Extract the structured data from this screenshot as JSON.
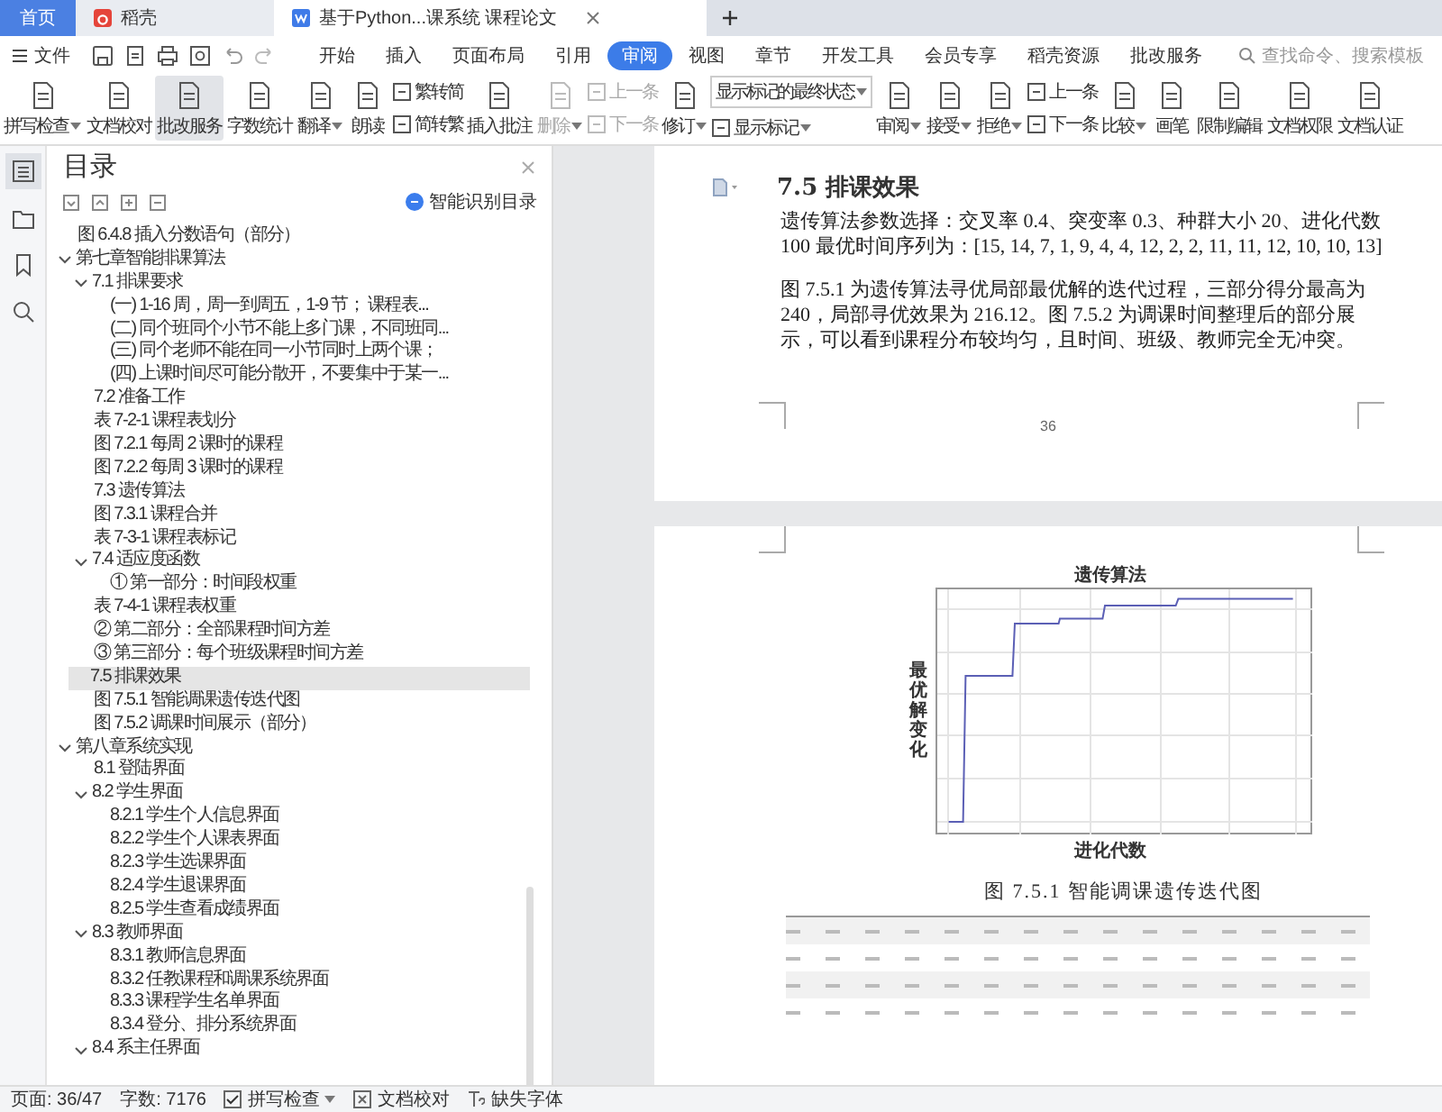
{
  "doc_tabs": [
    {
      "kind": "home",
      "label": "首页",
      "selected": false
    },
    {
      "kind": "app",
      "label": "稻壳",
      "selected": false
    },
    {
      "kind": "document",
      "label": "基于Python...课系统 课程论文",
      "selected": true
    }
  ],
  "menu": {
    "file_label": "文件",
    "tabs": [
      {
        "label": "开始",
        "selected": false
      },
      {
        "label": "插入",
        "selected": false
      },
      {
        "label": "页面布局",
        "selected": false
      },
      {
        "label": "引用",
        "selected": false
      },
      {
        "label": "审阅",
        "selected": true
      },
      {
        "label": "视图",
        "selected": false
      },
      {
        "label": "章节",
        "selected": false
      },
      {
        "label": "开发工具",
        "selected": false
      },
      {
        "label": "会员专享",
        "selected": false
      },
      {
        "label": "稻壳资源",
        "selected": false
      },
      {
        "label": "批改服务",
        "selected": false
      }
    ],
    "search": {
      "placeholder": "查找命令、搜索模板"
    }
  },
  "toolbar": [
    {
      "kind": "big",
      "label": "拼写检查",
      "dropdown": true,
      "disabled": false,
      "selected": false
    },
    {
      "kind": "big",
      "label": "文档校对",
      "dropdown": false,
      "disabled": false,
      "selected": false
    },
    {
      "kind": "big",
      "label": "批改服务",
      "dropdown": false,
      "disabled": false,
      "selected": true
    },
    {
      "kind": "big",
      "label": "字数统计",
      "dropdown": false,
      "disabled": false,
      "selected": false
    },
    {
      "kind": "big",
      "label": "翻译",
      "dropdown": true,
      "disabled": false,
      "selected": false
    },
    {
      "kind": "big",
      "label": "朗读",
      "dropdown": false,
      "disabled": false,
      "selected": false
    },
    {
      "kind": "pair",
      "items": [
        {
          "label": "繁转简",
          "disabled": false
        },
        {
          "label": "简转繁",
          "disabled": false
        }
      ]
    },
    {
      "kind": "big",
      "label": "插入批注",
      "dropdown": false,
      "disabled": false,
      "selected": false
    },
    {
      "kind": "big",
      "label": "删除",
      "dropdown": true,
      "disabled": true,
      "selected": false
    },
    {
      "kind": "pair",
      "items": [
        {
          "label": "上一条",
          "disabled": true
        },
        {
          "label": "下一条",
          "disabled": true
        }
      ]
    },
    {
      "kind": "big",
      "label": "修订",
      "dropdown": true,
      "disabled": false,
      "selected": false
    },
    {
      "kind": "select",
      "value": "显示标记的最终状态",
      "label": "显示标记"
    },
    {
      "kind": "big",
      "label": "审阅",
      "dropdown": true,
      "disabled": false,
      "selected": false
    },
    {
      "kind": "big",
      "label": "接受",
      "dropdown": true,
      "disabled": false,
      "selected": false
    },
    {
      "kind": "big",
      "label": "拒绝",
      "dropdown": true,
      "disabled": false,
      "selected": false
    },
    {
      "kind": "pair",
      "items": [
        {
          "label": "上一条",
          "disabled": false
        },
        {
          "label": "下一条",
          "disabled": false
        }
      ]
    },
    {
      "kind": "big",
      "label": "比较",
      "dropdown": true,
      "disabled": false,
      "selected": false
    },
    {
      "kind": "big",
      "label": "画笔",
      "dropdown": false,
      "disabled": false,
      "selected": false
    },
    {
      "kind": "big",
      "label": "限制编辑",
      "dropdown": false,
      "disabled": false,
      "selected": false
    },
    {
      "kind": "big",
      "label": "文档权限",
      "dropdown": false,
      "disabled": false,
      "selected": false
    },
    {
      "kind": "big",
      "label": "文档认证",
      "dropdown": false,
      "disabled": false,
      "selected": false
    }
  ],
  "rail": [
    {
      "kind": "contents",
      "selected": true
    },
    {
      "kind": "folder",
      "selected": false
    },
    {
      "kind": "bookmark",
      "selected": false
    },
    {
      "kind": "search",
      "selected": false
    }
  ],
  "toc": {
    "title": "目录",
    "smart_button": "智能识别目录",
    "items": [
      {
        "label": "图 6.4.8 插入分数语句（部分）",
        "selected": false
      },
      {
        "label": "第七章智能排课算法",
        "selected": false,
        "expanded": true,
        "children": [
          {
            "label": "7.1 排课要求",
            "selected": false,
            "expanded": true,
            "children": [
              {
                "label": "(一) 1-16 周，周一到周五，1-9 节； 课程表...",
                "selected": false
              },
              {
                "label": "(二) 同个班同个小节不能上多门课，不同班同...",
                "selected": false
              },
              {
                "label": "(三) 同个老师不能在同一小节同时上两个课；",
                "selected": false
              },
              {
                "label": "(四) 上课时间尽可能分散开，不要集中于某一...",
                "selected": false
              }
            ]
          },
          {
            "label": "7.2 准备工作",
            "selected": false
          },
          {
            "label": "表 7-2-1 课程表划分",
            "selected": false
          },
          {
            "label": "图 7.2.1 每周 2 课时的课程",
            "selected": false
          },
          {
            "label": "图 7.2.2 每周 3 课时的课程",
            "selected": false
          },
          {
            "label": "7.3 遗传算法",
            "selected": false
          },
          {
            "label": "图 7.3.1 课程合并",
            "selected": false
          },
          {
            "label": "表 7-3-1 课程表标记",
            "selected": false
          },
          {
            "label": "7.4 适应度函数",
            "selected": false,
            "expanded": true,
            "children": [
              {
                "label": "① 第一部分：时间段权重",
                "selected": false
              }
            ]
          },
          {
            "label": "表 7-4-1 课程表权重",
            "selected": false
          },
          {
            "label": "② 第二部分：全部课程时间方差",
            "selected": false
          },
          {
            "label": "③ 第三部分：每个班级课程时间方差",
            "selected": false
          },
          {
            "label": "7.5 排课效果",
            "selected": true
          },
          {
            "label": "图 7.5.1 智能调课遗传迭代图",
            "selected": false
          },
          {
            "label": "图 7.5.2 调课时间展示（部分）",
            "selected": false
          }
        ]
      },
      {
        "label": "第八章系统实现",
        "selected": false,
        "expanded": true,
        "children": [
          {
            "label": "8.1 登陆界面",
            "selected": false
          },
          {
            "label": "8.2 学生界面",
            "selected": false,
            "expanded": true,
            "children": [
              {
                "label": "8.2.1 学生个人信息界面",
                "selected": false
              },
              {
                "label": "8.2.2 学生个人课表界面",
                "selected": false
              },
              {
                "label": "8.2.3 学生选课界面",
                "selected": false
              },
              {
                "label": "8.2.4 学生退课界面",
                "selected": false
              },
              {
                "label": "8.2.5 学生查看成绩界面",
                "selected": false
              }
            ]
          },
          {
            "label": "8.3 教师界面",
            "selected": false,
            "expanded": true,
            "children": [
              {
                "label": "8.3.1 教师信息界面",
                "selected": false
              },
              {
                "label": "8.3.2 任教课程和调课系统界面",
                "selected": false
              },
              {
                "label": "8.3.3 课程学生名单界面",
                "selected": false
              },
              {
                "label": "8.3.4 登分、排分系统界面",
                "selected": false
              }
            ]
          },
          {
            "label": "8.4 系主任界面",
            "selected": false,
            "expanded": true
          }
        ]
      }
    ]
  },
  "page_top": {
    "heading": "7.5 排课效果",
    "paragraphs": [
      "遗传算法参数选择：交叉率 0.4、突变率 0.3、种群大小 20、进化代数 100 最优时间序列为：[15, 14, 7, 1, 9, 4, 4, 12, 2, 2, 11, 11, 12, 10, 10, 13]",
      "图 7.5.1 为遗传算法寻优局部最优解的迭代过程，三部分得分最高为 240，局部寻优效果为 216.12。图 7.5.2 为调课时间整理后的部分展示，可以看到课程分布较均匀，且时间、班级、教师完全无冲突。"
    ],
    "page_number": "36"
  },
  "page_bottom": {
    "chart": {
      "title": "遗传算法",
      "ylabel": "最优解变化",
      "xlabel": "进化代数"
    },
    "caption": "图 7.5.1 智能调课遗传迭代图"
  },
  "status_bar": {
    "page": "页面: 36/47",
    "words": "字数: 7176",
    "spell_check": {
      "label": "拼写检查",
      "checked": true
    },
    "proofread": "文档校对",
    "missing_fonts": "缺失字体"
  }
}
